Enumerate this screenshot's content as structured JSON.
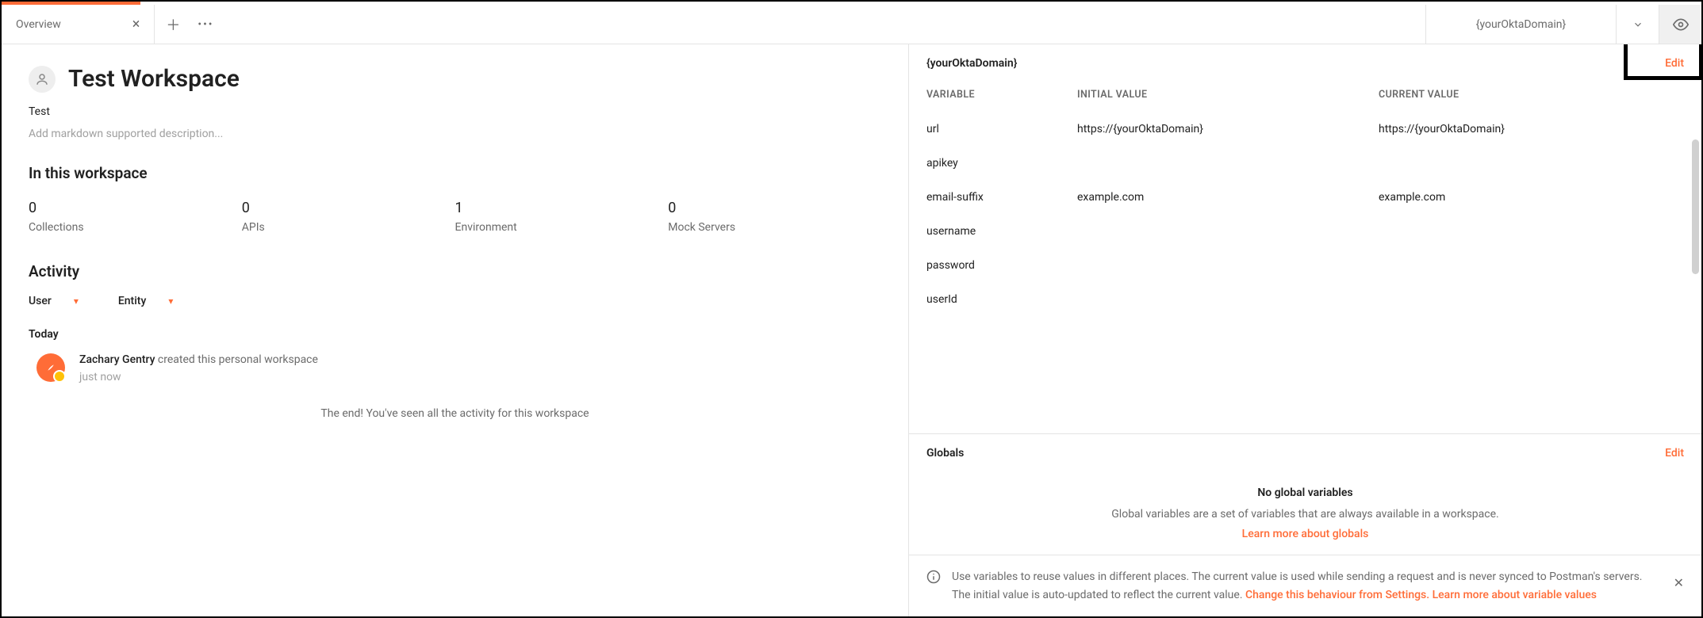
{
  "tabbar": {
    "tab_label": "Overview",
    "env_name": "{yourOktaDomain}"
  },
  "workspace": {
    "title": "Test Workspace",
    "subtitle": "Test",
    "description_placeholder": "Add markdown supported description...",
    "section_heading": "In this workspace",
    "stats": [
      {
        "count": "0",
        "label": "Collections"
      },
      {
        "count": "0",
        "label": "APIs"
      },
      {
        "count": "1",
        "label": "Environment"
      },
      {
        "count": "0",
        "label": "Mock Servers"
      }
    ],
    "activity_heading": "Activity",
    "filters": {
      "user": "User",
      "entity": "Entity"
    },
    "today_label": "Today",
    "activity": {
      "actor": "Zachary Gentry",
      "action": " created this personal workspace",
      "time": "just now"
    },
    "end_message": "The end! You've seen all the activity for this workspace"
  },
  "env_panel": {
    "title": "{yourOktaDomain}",
    "edit": "Edit",
    "headers": {
      "variable": "VARIABLE",
      "initial": "INITIAL VALUE",
      "current": "CURRENT VALUE"
    },
    "rows": [
      {
        "variable": "url",
        "initial": "https://{yourOktaDomain}",
        "current": "https://{yourOktaDomain}"
      },
      {
        "variable": "apikey",
        "initial": "",
        "current": ""
      },
      {
        "variable": "email-suffix",
        "initial": "example.com",
        "current": "example.com"
      },
      {
        "variable": "username",
        "initial": "",
        "current": ""
      },
      {
        "variable": "password",
        "initial": "",
        "current": ""
      },
      {
        "variable": "userId",
        "initial": "",
        "current": ""
      }
    ]
  },
  "globals": {
    "title": "Globals",
    "edit": "Edit",
    "empty_heading": "No global variables",
    "empty_desc": "Global variables are a set of variables that are always available in a workspace.",
    "learn_link": "Learn more about globals"
  },
  "info": {
    "text_1": "Use variables to reuse values in different places. The current value is used while sending a request and is never synced to Postman's servers. The initial value is auto-updated to reflect the current value. ",
    "link_1": "Change this behaviour from Settings.",
    "link_2": "Learn more about variable values"
  }
}
